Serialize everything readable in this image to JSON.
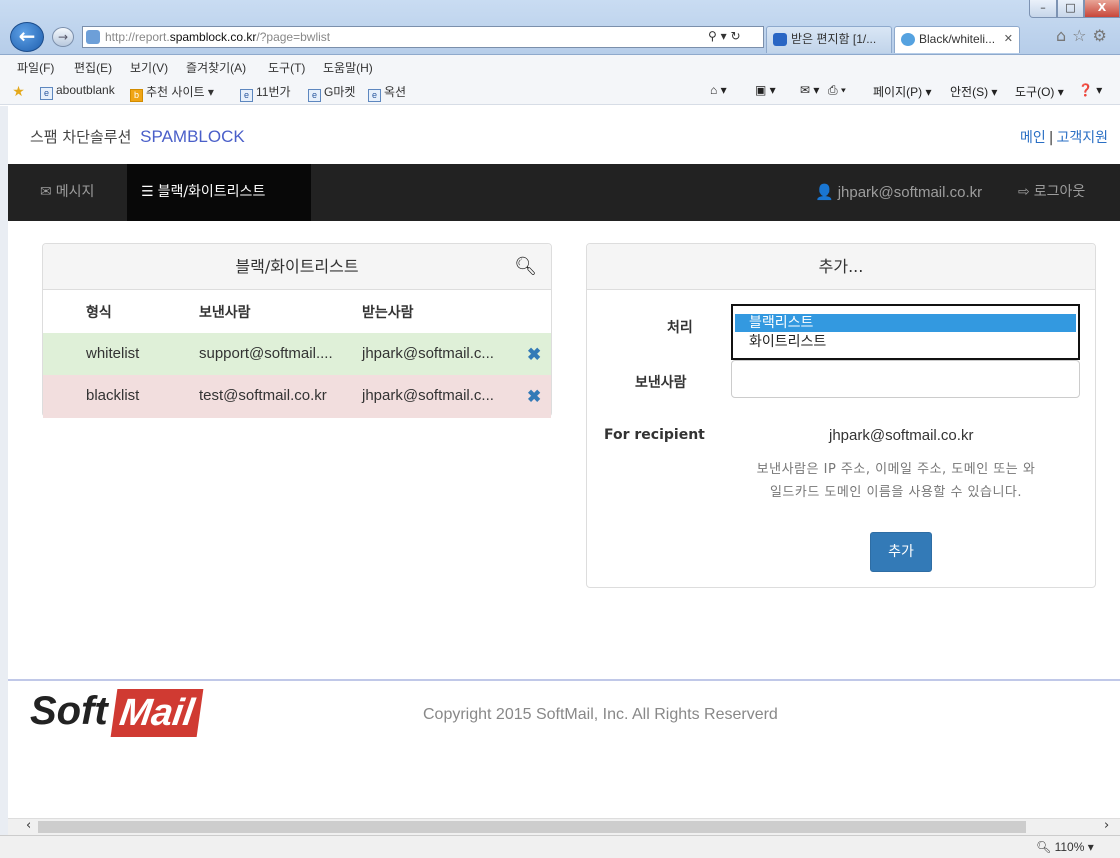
{
  "browser": {
    "url_prefix": "http://report.",
    "url_domain": "spamblock.co.kr",
    "url_path": "/?page=bwlist",
    "addr_tools": "⚲ ▾ ↻",
    "tabs": [
      {
        "label": "받은 편지함 [1/..."
      },
      {
        "label": "Black/whiteli..."
      }
    ],
    "menu": [
      "파일(F)",
      "편집(E)",
      "보기(V)",
      "즐겨찾기(A)",
      "도구(T)",
      "도움말(H)"
    ],
    "favorites": [
      {
        "label": "aboutblank"
      },
      {
        "label": "추천 사이트 ▾"
      },
      {
        "label": "11번가"
      },
      {
        "label": "G마켓"
      },
      {
        "label": "옥션"
      }
    ],
    "commands": [
      "페이지(P) ▾",
      "안전(S) ▾",
      "도구(O) ▾"
    ],
    "zoom": "110%"
  },
  "header": {
    "brand_ko": "스팸 차단솔루션",
    "brand_en": "SPAMBLOCK",
    "links": [
      "메인",
      "고객지원"
    ],
    "link_sep": "|"
  },
  "nav": {
    "messages": "메시지",
    "bwlist": "블랙/화이트리스트",
    "user": "jhpark@softmail.co.kr",
    "logout": "로그아웃"
  },
  "list_panel": {
    "title": "블랙/화이트리스트",
    "columns": [
      "형식",
      "보낸사람",
      "받는사람"
    ],
    "rows": [
      {
        "type": "whitelist",
        "sender": "support@softmail....",
        "recipient": "jhpark@softmail.c..."
      },
      {
        "type": "blacklist",
        "sender": "test@softmail.co.kr",
        "recipient": "jhpark@softmail.c..."
      }
    ]
  },
  "add_panel": {
    "title": "추가...",
    "action_label": "처리",
    "options": [
      "블랙리스트",
      "화이트리스트"
    ],
    "selected": "블랙리스트",
    "sender_label": "보낸사람",
    "sender_value": "",
    "recipient_label": "For recipient",
    "recipient_value": "jhpark@softmail.co.kr",
    "help_line1": "보낸사람은 IP 주소, 이메일 주소, 도메인 또는 와",
    "help_line2": "일드카드 도메인 이름을 사용할 수 있습니다.",
    "submit": "추가"
  },
  "footer": {
    "logo_soft": "Soft",
    "logo_mail": "Mail",
    "copyright": "Copyright 2015 SoftMail, Inc. All Rights Reserverd"
  },
  "colors": {
    "navbar": "#222222",
    "primary": "#337ab7",
    "whitelist_row": "#dff0d8",
    "blacklist_row": "#f2dede",
    "brand_accent": "#4a5fc9",
    "logo_red": "#d03a32"
  }
}
